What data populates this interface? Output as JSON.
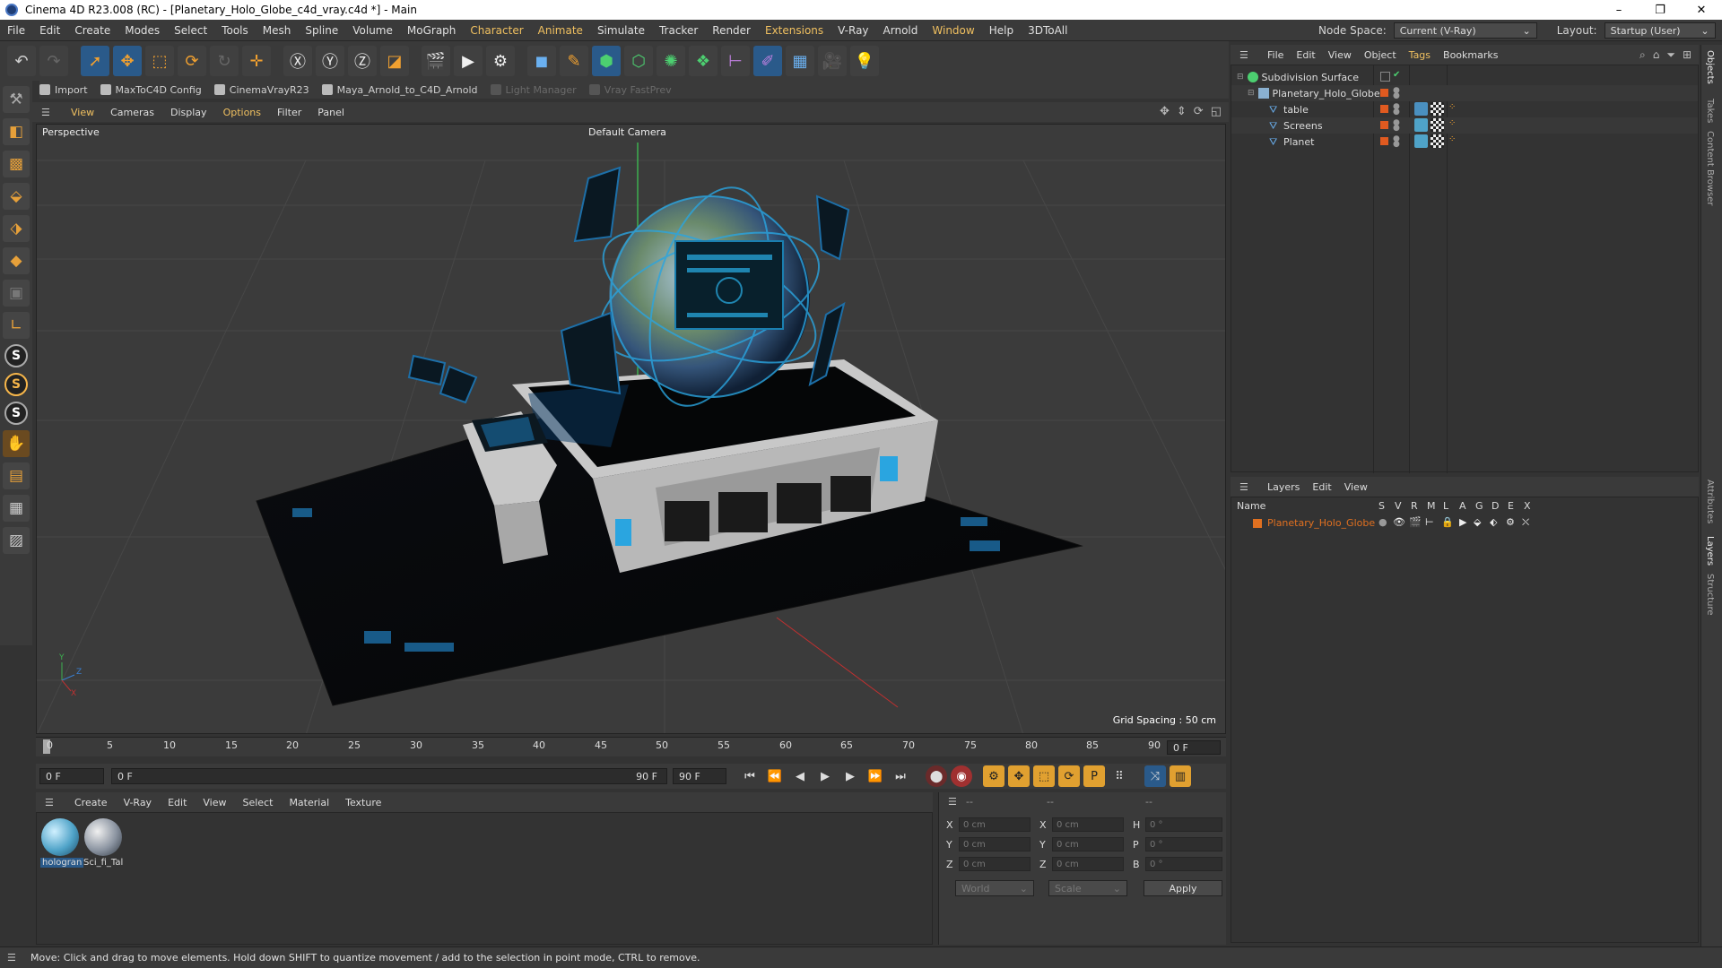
{
  "window": {
    "title": "Cinema 4D R23.008 (RC) - [Planetary_Holo_Globe_c4d_vray.c4d *] - Main",
    "minimize": "–",
    "restore": "❐",
    "close": "✕"
  },
  "menubar": {
    "items": [
      "File",
      "Edit",
      "Create",
      "Modes",
      "Select",
      "Tools",
      "Mesh",
      "Spline",
      "Volume",
      "MoGraph",
      "Character",
      "Animate",
      "Simulate",
      "Tracker",
      "Render",
      "Extensions",
      "V-Ray",
      "Arnold",
      "Window",
      "Help",
      "3DToAll"
    ],
    "node_space_label": "Node Space:",
    "node_space_value": "Current (V-Ray)",
    "layout_label": "Layout:",
    "layout_value": "Startup (User)"
  },
  "pluginbar": {
    "items": [
      "Import",
      "MaxToC4D Config",
      "CinemaVrayR23",
      "Maya_Arnold_to_C4D_Arnold",
      "Light Manager",
      "Vray FastPrev"
    ]
  },
  "viewport": {
    "menu": [
      "View",
      "Cameras",
      "Display",
      "Options",
      "Filter",
      "Panel"
    ],
    "label": "Perspective",
    "camera": "Default Camera",
    "grid_spacing": "Grid Spacing : 50 cm",
    "axis_y": "Y",
    "axis_z": "Z",
    "axis_x": "X"
  },
  "timeline": {
    "ticks": [
      "0",
      "5",
      "10",
      "15",
      "20",
      "25",
      "30",
      "35",
      "40",
      "45",
      "50",
      "55",
      "60",
      "65",
      "70",
      "75",
      "80",
      "85",
      "90"
    ],
    "current_frame": "0 F"
  },
  "transport": {
    "start": "0 F",
    "range_start": "0 F",
    "range_end": "90 F",
    "end": "90 F"
  },
  "material_manager": {
    "menu": [
      "Create",
      "V-Ray",
      "Edit",
      "View",
      "Select",
      "Material",
      "Texture"
    ],
    "materials": [
      {
        "name": "hologran",
        "color": "#4fa3c8"
      },
      {
        "name": "Sci_fi_Tal",
        "color": "#8a93a0"
      }
    ]
  },
  "coordinates": {
    "col1": {
      "header": "--",
      "rows": [
        {
          "axis": "X",
          "value": "0 cm"
        },
        {
          "axis": "Y",
          "value": "0 cm"
        },
        {
          "axis": "Z",
          "value": "0 cm"
        }
      ]
    },
    "col2": {
      "header": "--",
      "rows": [
        {
          "axis": "X",
          "value": "0 cm"
        },
        {
          "axis": "Y",
          "value": "0 cm"
        },
        {
          "axis": "Z",
          "value": "0 cm"
        }
      ]
    },
    "col3": {
      "header": "--",
      "rows": [
        {
          "axis": "H",
          "value": "0 °"
        },
        {
          "axis": "P",
          "value": "0 °"
        },
        {
          "axis": "B",
          "value": "0 °"
        }
      ]
    },
    "mode1": "World",
    "mode2": "Scale",
    "apply": "Apply"
  },
  "object_manager": {
    "menu": [
      "File",
      "Edit",
      "View",
      "Object",
      "Tags",
      "Bookmarks"
    ],
    "objects": [
      {
        "name": "Subdivision Surface",
        "indent": 0
      },
      {
        "name": "Planetary_Holo_Globe",
        "indent": 1
      },
      {
        "name": "table",
        "indent": 2
      },
      {
        "name": "Screens",
        "indent": 2
      },
      {
        "name": "Planet",
        "indent": 2
      }
    ]
  },
  "layer_manager": {
    "menu": [
      "Layers",
      "Edit",
      "View"
    ],
    "columns": [
      "Name",
      "S",
      "V",
      "R",
      "M",
      "L",
      "A",
      "G",
      "D",
      "E",
      "X"
    ],
    "layers": [
      {
        "name": "Planetary_Holo_Globe",
        "color": "#e07020"
      }
    ]
  },
  "side_tabs": [
    "Objects",
    "Takes",
    "Content Browser",
    "Attributes",
    "Layers",
    "Structure"
  ],
  "status": {
    "text": "Move: Click and drag to move elements. Hold down SHIFT to quantize movement / add to the selection in point mode, CTRL to remove."
  },
  "colors": {
    "accent_orange": "#f0a030",
    "highlight_menu": "#f0c060",
    "layer_color": "#e07020",
    "object_check": "#e05a20"
  }
}
